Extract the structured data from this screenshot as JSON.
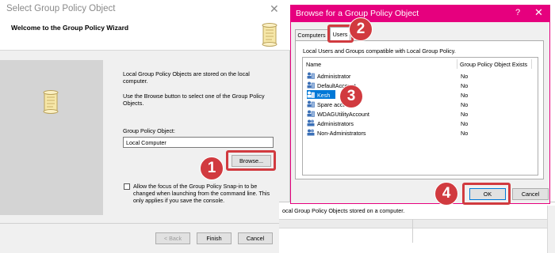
{
  "wizard": {
    "title": "Select Group Policy Object",
    "close_glyph": "✕",
    "heading": "Welcome to the Group Policy Wizard",
    "header_icon": "scroll-icon",
    "side_icon": "scroll-icon",
    "description_1": "Local Group Policy Objects are stored on the local computer.",
    "description_2": "Use the Browse button to select one of the Group Policy Objects.",
    "gpo_label": "Group Policy Object:",
    "gpo_value": "Local Computer",
    "browse_label": "Browse...",
    "allow_focus_text": "Allow the focus of the Group Policy Snap-in to be changed when launching from the command line.  This only applies if you save the console.",
    "allow_focus_checked": false,
    "back_label": "< Back",
    "finish_label": "Finish",
    "cancel_label": "Cancel"
  },
  "console": {
    "text": "ocal Group Policy Objects stored on a computer."
  },
  "browse_dialog": {
    "title": "Browse for a Group Policy Object",
    "help_glyph": "?",
    "close_glyph": "✕",
    "tabs": [
      {
        "label": "Computers",
        "active": false
      },
      {
        "label": "Users",
        "active": true
      }
    ],
    "description": "Local Users and Groups compatible with Local Group Policy.",
    "columns": {
      "name": "Name",
      "gpo_exists": "Group Policy Object Exists"
    },
    "rows": [
      {
        "name": "Administrator",
        "gpo_exists": "No",
        "selected": false
      },
      {
        "name": "DefaultAccount",
        "gpo_exists": "No",
        "selected": false
      },
      {
        "name": "Kesh",
        "gpo_exists": "No",
        "selected": true
      },
      {
        "name": "Spare acct",
        "gpo_exists": "No",
        "selected": false
      },
      {
        "name": "WDAGUtilityAccount",
        "gpo_exists": "No",
        "selected": false
      },
      {
        "name": "Administrators",
        "gpo_exists": "No",
        "selected": false
      },
      {
        "name": "Non-Administrators",
        "gpo_exists": "No",
        "selected": false
      }
    ],
    "ok_label": "OK",
    "cancel_label": "Cancel"
  },
  "steps": [
    "1",
    "2",
    "3",
    "4"
  ],
  "colors": {
    "accent_pink": "#e6007e",
    "highlight_red": "#d13a3f",
    "selection_blue": "#0078d7"
  }
}
